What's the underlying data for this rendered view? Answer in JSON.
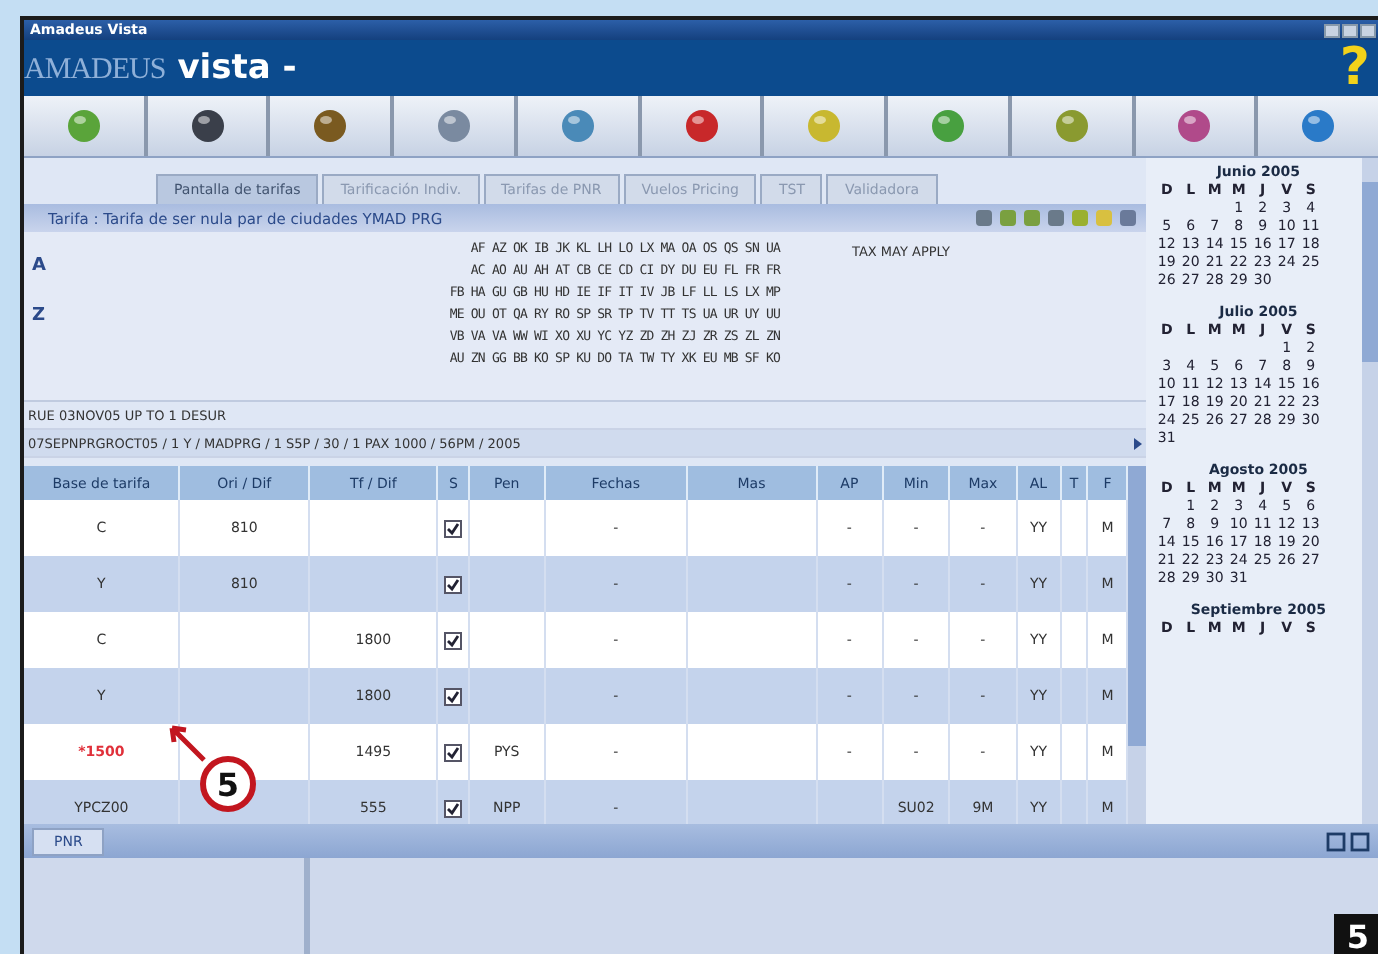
{
  "window": {
    "title": "Amadeus Vista"
  },
  "logo": {
    "brand": "AMADEUS",
    "product": "vista -"
  },
  "help": "?",
  "tabs": [
    {
      "label": "Pantalla de tarifas",
      "selected": true
    },
    {
      "label": "Tarificación Indiv.",
      "selected": false
    },
    {
      "label": "Tarifas de PNR",
      "selected": false
    },
    {
      "label": "Vuelos Pricing",
      "selected": false
    },
    {
      "label": "TST",
      "selected": false
    },
    {
      "label": "Validadora",
      "selected": false
    }
  ],
  "panel_title": "Tarifa : Tarifa de ser nula par de ciudades YMAD PRG",
  "codes": {
    "marks": [
      "A",
      "Z"
    ],
    "lines": [
      "AF AZ OK IB JK KL LH LO LX MA OA OS QS SN UA",
      "AC AO AU AH AT CB CE CD CI DY DU EU FL FR FR",
      "FB HA GU GB HU HD IE IF IT IV JB LF LL LS LX MP",
      "ME OU OT QA RY RO SP SR TP TV TT TS UA UR UY UU",
      "VB VA VA WW WI XO XU YC YZ ZD ZH ZJ ZR ZS ZL ZN",
      "AU ZN GG BB KO SP KU DO TA TW TY XK EU MB SF KO"
    ],
    "note": "TAX MAY APPLY"
  },
  "info_lines": [
    "RUE 03NOV05 UP TO 1 DESUR",
    "07SEPNPRGROCT05 / 1 Y / MADPRG / 1 S5P / 30 / 1 PAX 1000 / 56PM / 2005"
  ],
  "table": {
    "columns": [
      "Base de tarifa",
      "Ori / Dif",
      "Tf / Dif",
      "S",
      "Pen",
      "Fechas",
      "Mas",
      "AP",
      "Min",
      "Max",
      "AL",
      "T",
      "F"
    ],
    "rows": [
      {
        "cells": [
          "C",
          "810",
          "",
          "",
          "",
          "-",
          "",
          "-",
          "-",
          "-",
          "YY",
          "",
          "M"
        ],
        "checked": true,
        "alert": false
      },
      {
        "cells": [
          "Y",
          "810",
          "",
          "",
          "",
          "-",
          "",
          "-",
          "-",
          "-",
          "YY",
          "",
          "M"
        ],
        "checked": true,
        "alert": false
      },
      {
        "cells": [
          "C",
          "",
          "1800",
          "",
          "",
          "-",
          "",
          "-",
          "-",
          "-",
          "YY",
          "",
          "M"
        ],
        "checked": true,
        "alert": false
      },
      {
        "cells": [
          "Y",
          "",
          "1800",
          "",
          "",
          "-",
          "",
          "-",
          "-",
          "-",
          "YY",
          "",
          "M"
        ],
        "checked": true,
        "alert": false
      },
      {
        "cells": [
          "*1500",
          "",
          "1495",
          "",
          "PYS",
          "-",
          "",
          "-",
          "-",
          "-",
          "YY",
          "",
          "M"
        ],
        "checked": true,
        "alert": true
      },
      {
        "cells": [
          "YPCZ00",
          "",
          "555",
          "",
          "NPP",
          "-",
          "",
          "",
          "SU02",
          "9M",
          "YY",
          "",
          "M"
        ],
        "checked": true,
        "alert": false
      }
    ]
  },
  "bottom_tabs": [
    {
      "label": "PNR",
      "selected": true
    }
  ],
  "calendars": [
    {
      "title": "Junio 2005",
      "weekdays": [
        "D",
        "L",
        "M",
        "M",
        "J",
        "V",
        "S"
      ],
      "weeks": [
        [
          "1",
          "2",
          "3",
          "4"
        ],
        [
          "5",
          "6",
          "7",
          "8",
          "9",
          "10",
          "11"
        ],
        [
          "12",
          "13",
          "14",
          "15",
          "16",
          "17",
          "18"
        ],
        [
          "19",
          "20",
          "21",
          "22",
          "23",
          "24",
          "25"
        ],
        [
          "26",
          "27",
          "28",
          "29",
          "30"
        ]
      ]
    },
    {
      "title": "Julio 2005",
      "weekdays": [
        "D",
        "L",
        "M",
        "M",
        "J",
        "V",
        "S"
      ],
      "weeks": [
        [
          "1",
          "2"
        ],
        [
          "3",
          "4",
          "5",
          "6",
          "7",
          "8",
          "9"
        ],
        [
          "10",
          "11",
          "12",
          "13",
          "14",
          "15",
          "16"
        ],
        [
          "17",
          "18",
          "19",
          "20",
          "21",
          "22",
          "23"
        ],
        [
          "24",
          "25",
          "26",
          "27",
          "28",
          "29",
          "30"
        ],
        [
          "31"
        ]
      ]
    },
    {
      "title": "Agosto 2005",
      "weekdays": [
        "D",
        "L",
        "M",
        "M",
        "J",
        "V",
        "S"
      ],
      "weeks": [
        [
          "1",
          "2",
          "3",
          "4",
          "5",
          "6"
        ],
        [
          "7",
          "8",
          "9",
          "10",
          "11",
          "12",
          "13"
        ],
        [
          "14",
          "15",
          "16",
          "17",
          "18",
          "19",
          "20"
        ],
        [
          "21",
          "22",
          "23",
          "24",
          "25",
          "26",
          "27"
        ],
        [
          "28",
          "29",
          "30",
          "31"
        ]
      ]
    },
    {
      "title": "Septiembre 2005",
      "weekdays": [
        "D",
        "L",
        "M",
        "M",
        "J",
        "V",
        "S"
      ]
    }
  ],
  "callout": "5",
  "figure_number": "5"
}
